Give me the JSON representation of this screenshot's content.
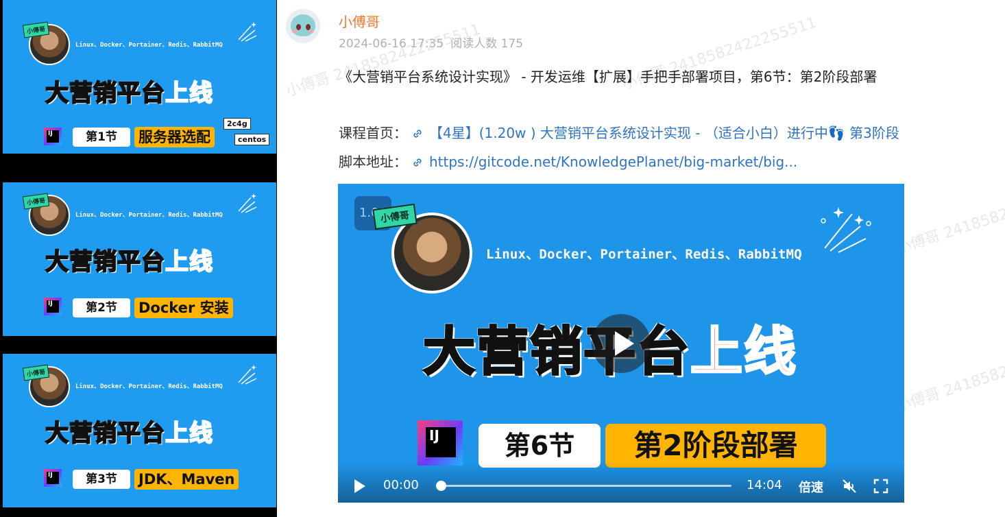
{
  "thumbnails": [
    {
      "tag": "小傅哥",
      "subtitle": "Linux、Docker、Portainer、Redis、RabbitMQ",
      "title_main": "大营销平台",
      "title_highlight": "上线",
      "ij": "IJ",
      "lesson": "第1节",
      "topic": "服务器选配",
      "badge_top": "2c4g",
      "badge_bottom": "centos"
    },
    {
      "tag": "小傅哥",
      "subtitle": "Linux、Docker、Portainer、Redis、RabbitMQ",
      "title_main": "大营销平台",
      "title_highlight": "上线",
      "ij": "IJ",
      "lesson": "第2节",
      "topic": "Docker 安装"
    },
    {
      "tag": "小傅哥",
      "subtitle": "Linux、Docker、Portainer、Redis、RabbitMQ",
      "title_main": "大营销平台",
      "title_highlight": "上线",
      "ij": "IJ",
      "lesson": "第3节",
      "topic": "JDK、Maven"
    }
  ],
  "post": {
    "author": "小傅哥",
    "date": "2024-06-16 17:35",
    "reads": "阅读人数 175",
    "intro": "《大营销平台系统设计实现》 - 开发运维【扩展】手把手部署项目，第6节：第2阶段部署",
    "course_label": "课程首页：",
    "course_link": "【4星】(1.20w ) 大营销平台系统设计实现 - （适合小白）进行中👣 第3阶段",
    "script_label": "脚本地址：",
    "script_link": "https://gitcode.net/KnowledgePlanet/big-market/big..."
  },
  "video": {
    "speed_badge": "1.00",
    "tag": "小傅哥",
    "subtitle": "Linux、Docker、Portainer、Redis、RabbitMQ",
    "title_main": "大营销平台",
    "title_highlight": "上线",
    "ij": "IJ",
    "lesson": "第6节",
    "topic": "第2阶段部署",
    "current_time": "00:00",
    "duration": "14:04",
    "rate_label": "倍速",
    "progress": 0
  },
  "icons": {
    "link": "link-icon",
    "mute": "speaker-muted-icon",
    "fullscreen": "fullscreen-icon"
  },
  "colors": {
    "accent": "#f0782a",
    "link": "#2f73c4",
    "video_bg": "#1f95ea",
    "highlight": "#ff4a5a",
    "topic_bg": "#ffb400"
  },
  "watermark": "小傅哥 2418582422255511"
}
